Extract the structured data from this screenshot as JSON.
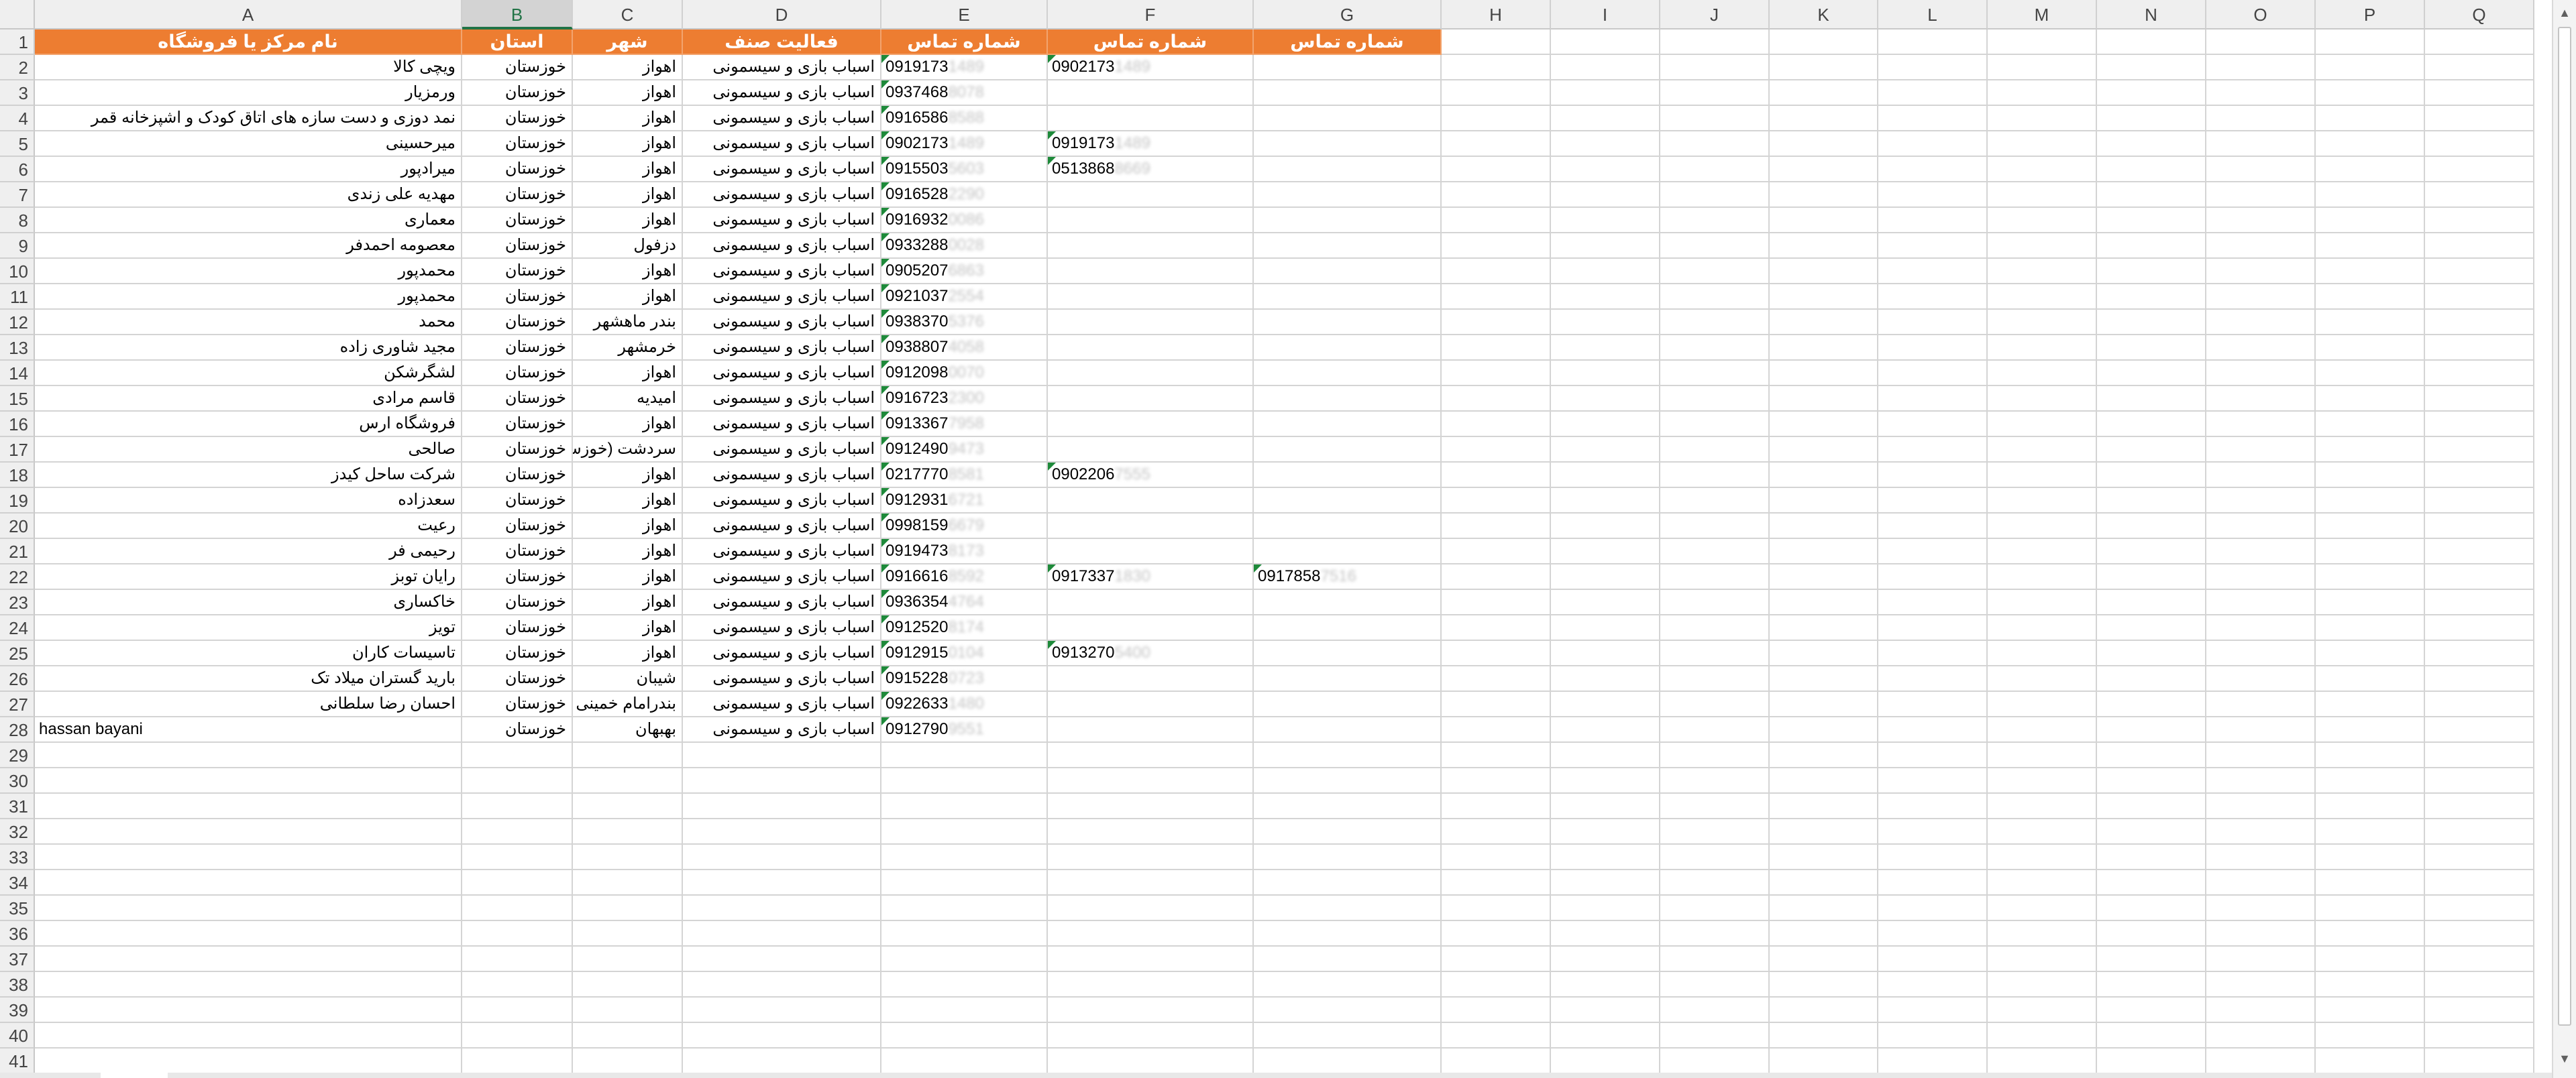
{
  "columns": [
    "A",
    "B",
    "C",
    "D",
    "E",
    "F",
    "G",
    "H",
    "I",
    "J",
    "K",
    "L",
    "M",
    "N",
    "O",
    "P",
    "Q"
  ],
  "selected_column": "B",
  "header_row": {
    "A": "نام مرکز یا فروشگاه",
    "B": "استان",
    "C": "شهر",
    "D": "فعالیت صنف",
    "E": "شماره تماس",
    "F": "شماره تماس",
    "G": "شماره تماس"
  },
  "rows": [
    {
      "A": "ویچی کالا",
      "B": "خوزستان",
      "C": "اهواز",
      "D": "اسباب بازی و سیسمونی",
      "E": [
        "0919173",
        "1489"
      ],
      "F": [
        "0902173",
        "1489"
      ]
    },
    {
      "A": "ورمزیار",
      "B": "خوزستان",
      "C": "اهواز",
      "D": "اسباب بازی و سیسمونی",
      "E": [
        "0937468",
        "8078"
      ]
    },
    {
      "A": "نمد دوزی و دست سازه های اتاق کودک و اشپزخانه  قمر",
      "B": "خوزستان",
      "C": "اهواز",
      "D": "اسباب بازی و سیسمونی",
      "E": [
        "0916586",
        "8588"
      ]
    },
    {
      "A": "میرحسینی",
      "B": "خوزستان",
      "C": "اهواز",
      "D": "اسباب بازی و سیسمونی",
      "E": [
        "0902173",
        "1489"
      ],
      "F": [
        "0919173",
        "1489"
      ]
    },
    {
      "A": "میرادپور",
      "B": "خوزستان",
      "C": "اهواز",
      "D": "اسباب بازی و سیسمونی",
      "E": [
        "0915503",
        "5603"
      ],
      "F": [
        "0513868",
        "8669"
      ]
    },
    {
      "A": "مهدیه علی زندی",
      "B": "خوزستان",
      "C": "اهواز",
      "D": "اسباب بازی و سیسمونی",
      "E": [
        "0916528",
        "2290"
      ]
    },
    {
      "A": "معماری",
      "B": "خوزستان",
      "C": "اهواز",
      "D": "اسباب بازی و سیسمونی",
      "E": [
        "0916932",
        "0086"
      ]
    },
    {
      "A": "معصومه احمدفر",
      "B": "خوزستان",
      "C": "دزفول",
      "D": "اسباب بازی و سیسمونی",
      "E": [
        "0933288",
        "0028"
      ]
    },
    {
      "A": "محمدپور",
      "B": "خوزستان",
      "C": "اهواز",
      "D": "اسباب بازی و سیسمونی",
      "E": [
        "0905207",
        "6863"
      ]
    },
    {
      "A": "محمدپور",
      "B": "خوزستان",
      "C": "اهواز",
      "D": "اسباب بازی و سیسمونی",
      "E": [
        "0921037",
        "2554"
      ]
    },
    {
      "A": "محمد",
      "B": "خوزستان",
      "C": "بندر ماهشهر",
      "D": "اسباب بازی و سیسمونی",
      "E": [
        "0938370",
        "5376"
      ]
    },
    {
      "A": "مجید شاوری زاده",
      "B": "خوزستان",
      "C": "خرمشهر",
      "D": "اسباب بازی و سیسمونی",
      "E": [
        "0938807",
        "4058"
      ]
    },
    {
      "A": "لشگرشکن",
      "B": "خوزستان",
      "C": "اهواز",
      "D": "اسباب بازی و سیسمونی",
      "E": [
        "0912098",
        "0070"
      ]
    },
    {
      "A": "قاسم مرادی",
      "B": "خوزستان",
      "C": "امیدیه",
      "D": "اسباب بازی و سیسمونی",
      "E": [
        "0916723",
        "2300"
      ]
    },
    {
      "A": "فروشگاه ارس",
      "B": "خوزستان",
      "C": "اهواز",
      "D": "اسباب بازی و سیسمونی",
      "E": [
        "0913367",
        "7958"
      ]
    },
    {
      "A": "صالحی",
      "B": "خوزستان",
      "C": "سردشت (خوزستخوزستان",
      "D": "اسباب بازی و سیسمونی",
      "E": [
        "0912490",
        "9473"
      ]
    },
    {
      "A": "شرکت ساحل کیدز",
      "B": "خوزستان",
      "C": "اهواز",
      "D": "اسباب بازی و سیسمونی",
      "E": [
        "0217770",
        "8581"
      ],
      "F": [
        "0902206",
        "7555"
      ]
    },
    {
      "A": "سعدزاده",
      "B": "خوزستان",
      "C": "اهواز",
      "D": "اسباب بازی و سیسمونی",
      "E": [
        "0912931",
        "6721"
      ]
    },
    {
      "A": "رعیت",
      "B": "خوزستان",
      "C": "اهواز",
      "D": "اسباب بازی و سیسمونی",
      "E": [
        "0998159",
        "6679"
      ]
    },
    {
      "A": "رحیمی فر",
      "B": "خوزستان",
      "C": "اهواز",
      "D": "اسباب بازی و سیسمونی",
      "E": [
        "0919473",
        "8173"
      ]
    },
    {
      "A": "رایان توبز",
      "B": "خوزستان",
      "C": "اهواز",
      "D": "اسباب بازی و سیسمونی",
      "E": [
        "0916616",
        "8592"
      ],
      "F": [
        "0917337",
        "1830"
      ],
      "G": [
        "0917858",
        "7516"
      ]
    },
    {
      "A": "خاکساری",
      "B": "خوزستان",
      "C": "اهواز",
      "D": "اسباب بازی و سیسمونی",
      "E": [
        "0936354",
        "4764"
      ]
    },
    {
      "A": "تویز",
      "B": "خوزستان",
      "C": "اهواز",
      "D": "اسباب بازی و سیسمونی",
      "E": [
        "0912520",
        "8174"
      ]
    },
    {
      "A": "تاسیسات کاران",
      "B": "خوزستان",
      "C": "اهواز",
      "D": "اسباب بازی و سیسمونی",
      "E": [
        "0912915",
        "0104"
      ],
      "F": [
        "0913270",
        "5400"
      ]
    },
    {
      "A": "بارید گستران میلاد تک",
      "B": "خوزستان",
      "C": "شیبان",
      "D": "اسباب بازی و سیسمونی",
      "E": [
        "0915228",
        "0723"
      ]
    },
    {
      "A": "احسان رضا سلطانی",
      "B": "خوزستان",
      "C": "بندرامام خمینی",
      "D": "اسباب بازی و سیسمونی",
      "E": [
        "0922633",
        "1480"
      ]
    },
    {
      "A": "hassan bayani",
      "B": "خوزستان",
      "C": "بهبهان",
      "D": "اسباب بازی و سیسمونی",
      "E": [
        "0912790",
        "9551"
      ]
    }
  ],
  "total_rows": 41,
  "colors": {
    "header_fill": "#ed7d31",
    "header_text": "#ffffff",
    "gridline": "#d4d4d4",
    "selection_accent": "#217346",
    "error_indicator": "#1e8a3a"
  },
  "icons": {
    "scroll_up": "scroll-up-arrow-icon",
    "scroll_down": "scroll-down-arrow-icon",
    "number_as_text_flag": "green-triangle-icon"
  },
  "scroll_up_glyph": "▲",
  "scroll_down_glyph": "▼"
}
